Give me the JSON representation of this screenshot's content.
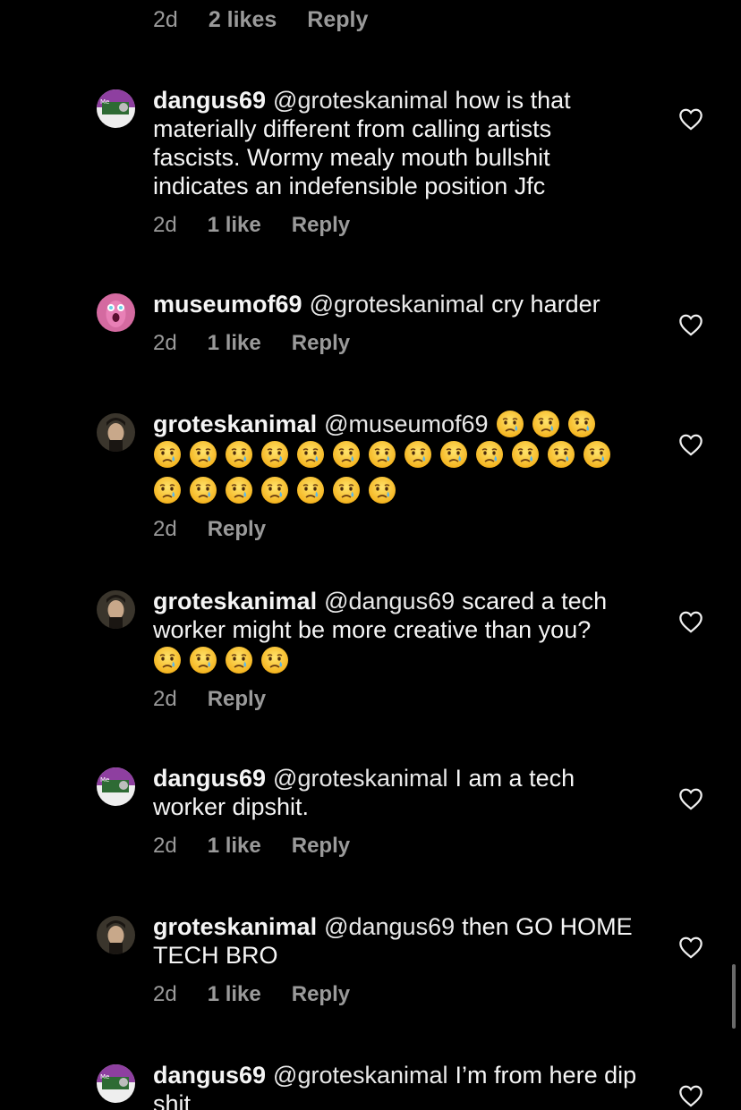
{
  "top_meta": {
    "time": "2d",
    "likes": "2 likes",
    "reply": "Reply"
  },
  "comments": [
    {
      "username": "dangus69",
      "mention": "@groteskanimal",
      "text": "how is that materially different from calling artists fascists. Wormy mealy mouth bullshit indicates an indefensible position Jfc",
      "time": "2d",
      "likes": "1 like",
      "reply": "Reply",
      "avatar_color": "#8e3fa0"
    },
    {
      "username": "museumof69",
      "mention": "@groteskanimal",
      "text": "cry harder",
      "time": "2d",
      "likes": "1 like",
      "reply": "Reply",
      "avatar_color": "#d46aa0"
    },
    {
      "username": "groteskanimal",
      "mention": "@museumof69",
      "text": "",
      "emoji": "crying-face",
      "emoji_count": 23,
      "time": "2d",
      "reply": "Reply",
      "avatar_color": "#2a2620"
    },
    {
      "username": "groteskanimal",
      "mention": "@dangus69",
      "text": "scared a tech worker might be more creative than you?",
      "emoji": "crying-face",
      "emoji_count": 4,
      "time": "2d",
      "reply": "Reply",
      "avatar_color": "#2a2620"
    },
    {
      "username": "dangus69",
      "mention": "@groteskanimal",
      "text": "I am a tech worker dipshit.",
      "time": "2d",
      "likes": "1 like",
      "reply": "Reply",
      "avatar_color": "#8e3fa0"
    },
    {
      "username": "groteskanimal",
      "mention": "@dangus69",
      "text": "then GO HOME TECH BRO",
      "time": "2d",
      "likes": "1 like",
      "reply": "Reply",
      "avatar_color": "#2a2620"
    },
    {
      "username": "dangus69",
      "mention": "@groteskanimal",
      "text": "I’m from here dip shit",
      "avatar_color": "#8e3fa0"
    }
  ],
  "colors": {
    "background": "#000000",
    "text": "#f5f5f5",
    "secondary": "#9a9a9a"
  }
}
